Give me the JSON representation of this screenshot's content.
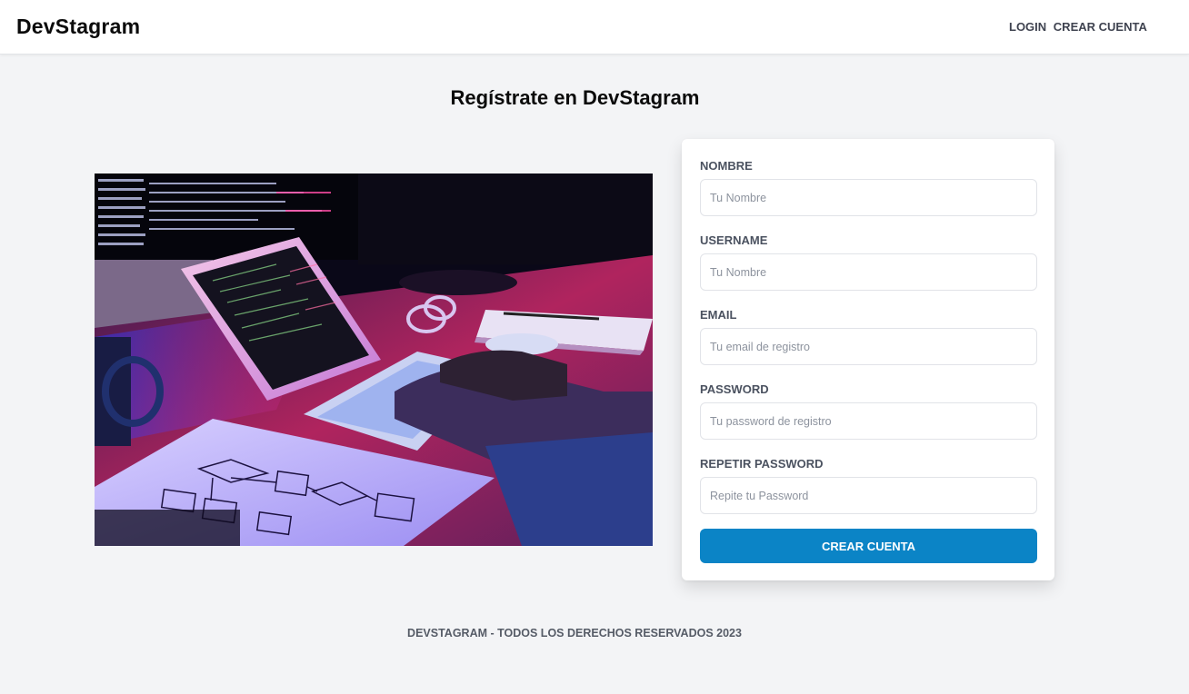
{
  "header": {
    "logo": "DevStagram",
    "nav": {
      "login": "LOGIN",
      "register": "CREAR CUENTA"
    }
  },
  "page": {
    "title": "Regístrate en DevStagram"
  },
  "form": {
    "fields": [
      {
        "label": "NOMBRE",
        "placeholder": "Tu Nombre",
        "value": ""
      },
      {
        "label": "USERNAME",
        "placeholder": "Tu Nombre",
        "value": ""
      },
      {
        "label": "EMAIL",
        "placeholder": "Tu email de registro",
        "value": ""
      },
      {
        "label": "PASSWORD",
        "placeholder": "Tu password de registro",
        "value": ""
      },
      {
        "label": "REPETIR PASSWORD",
        "placeholder": "Repite tu Password",
        "value": ""
      }
    ],
    "submit_label": "CREAR CUENTA"
  },
  "footer": {
    "text": "DEVSTAGRAM - TODOS LOS DERECHOS RESERVADOS 2023"
  },
  "colors": {
    "accent": "#0b84c6",
    "background": "#f3f4f6"
  }
}
